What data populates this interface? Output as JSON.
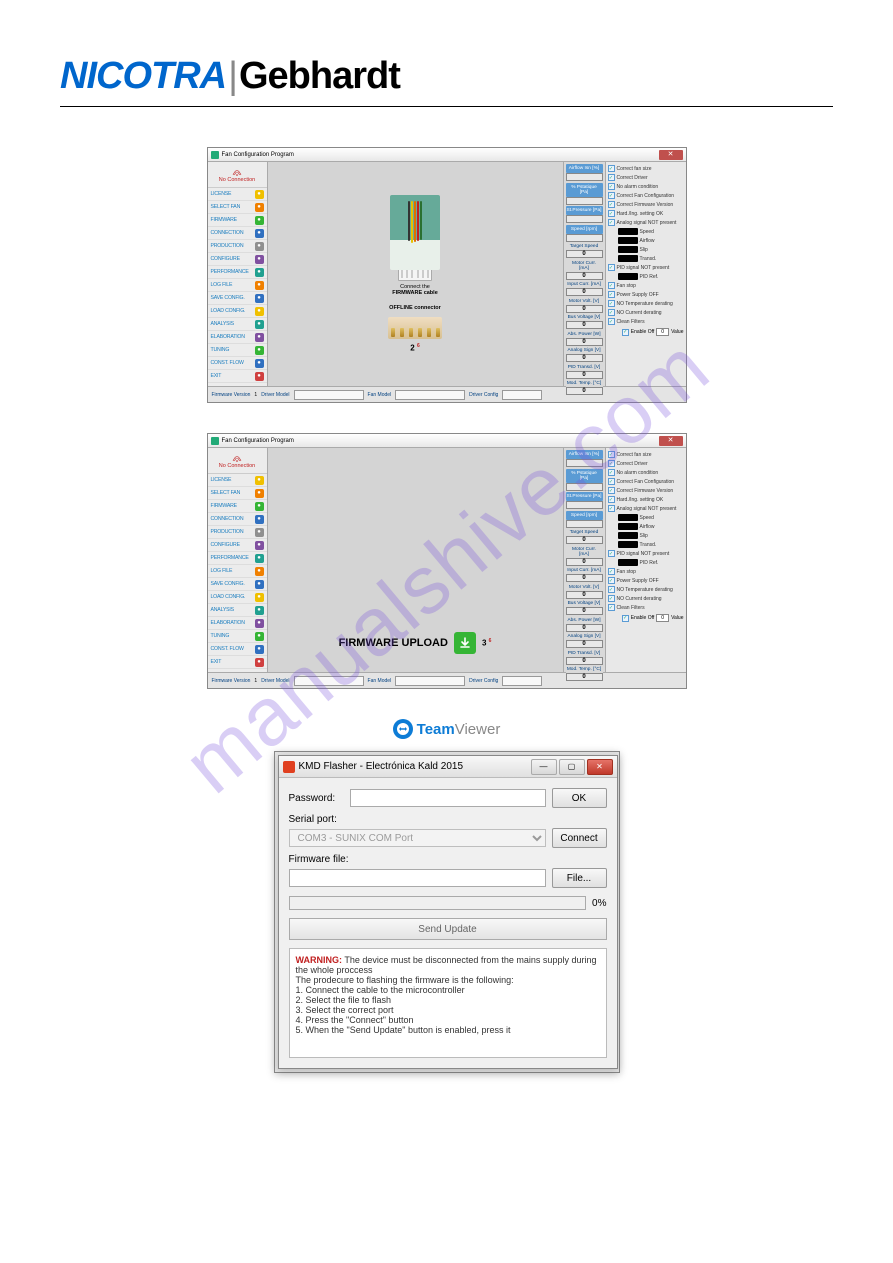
{
  "brand": {
    "left": "NICOTRA",
    "right": "Gebhardt"
  },
  "watermark": "manualshive.com",
  "app": {
    "title": "Fan Configuration Program",
    "no_connection": "No Connection",
    "sidebar": [
      {
        "label": "LICENSE",
        "icn": "icn-yellow"
      },
      {
        "label": "SELECT FAN",
        "icn": "icn-orange"
      },
      {
        "label": "FIRMWARE",
        "icn": "icn-green"
      },
      {
        "label": "CONNECTION",
        "icn": "icn-blue"
      },
      {
        "label": "PRODUCTION",
        "icn": "icn-gray"
      },
      {
        "label": "CONFIGURE",
        "icn": "icn-purple"
      },
      {
        "label": "PERFORMANCE",
        "icn": "icn-teal"
      },
      {
        "label": "LOG FILE",
        "icn": "icn-orange"
      },
      {
        "label": "SAVE CONFIG.",
        "icn": "icn-blue"
      },
      {
        "label": "LOAD CONFIG.",
        "icn": "icn-yellow"
      },
      {
        "label": "ANALYSIS",
        "icn": "icn-teal"
      },
      {
        "label": "ELABORATION",
        "icn": "icn-purple"
      },
      {
        "label": "TUNING",
        "icn": "icn-green"
      },
      {
        "label": "CONST. FLOW",
        "icn": "icn-blue"
      },
      {
        "label": "EXIT",
        "icn": "icn-red"
      }
    ],
    "right_values": [
      {
        "label": "Airflow Isn [%]",
        "btn": true,
        "val": ""
      },
      {
        "label": "% Pstatique [Pa]",
        "btn": true,
        "val": ""
      },
      {
        "label": "St.Pressure [Pa]",
        "btn": true,
        "val": ""
      },
      {
        "label": "Speed [rpm]",
        "btn": true,
        "val": ""
      },
      {
        "label": "Target Speed",
        "val": "0"
      },
      {
        "label": "Motor Curr. [mA]",
        "val": "0"
      },
      {
        "label": "Input Curr. [mA]",
        "val": "0"
      },
      {
        "label": "Motor Volt. [V]",
        "val": "0"
      },
      {
        "label": "Bus Voltage [V]",
        "val": "0"
      },
      {
        "label": "Abs. Power [W]",
        "val": "0"
      },
      {
        "label": "Analog Sign [V]",
        "val": "0"
      },
      {
        "label": "PID Transd. [V]",
        "val": "0"
      },
      {
        "label": "Mod. Temp. [°C]",
        "val": "0"
      }
    ],
    "checks_top": [
      "Correct fan size",
      "Correct Driver",
      "No alarm condition",
      "Correct  Fan Configuration",
      "Correct Firmware Version",
      "Hard./Ing. setting OK",
      "Analog signal NOT present"
    ],
    "indicators": [
      "Speed",
      "Airflow",
      "Slip",
      "Transd."
    ],
    "checks_mid": [
      "PID signal NOT present"
    ],
    "indicators2": [
      "PID Ref."
    ],
    "checks_bot": [
      "Fan stop",
      "Power Supply OFF",
      "NO Temperature derating",
      "NO Current derating",
      "Clean Filters"
    ],
    "enable_off": {
      "label": "Enable Off",
      "val": "0",
      "unit": "Value"
    },
    "footer": {
      "firmware": "Firmware Version",
      "n": "1",
      "driver": "Driver Model",
      "fan": "Fan Model",
      "cfg": "Driver Config"
    },
    "center1": {
      "connect": "Connect the",
      "fw_cable": "FIRMWARE cable",
      "offline": "OFFLINE connector",
      "step": "2",
      "pager": "6"
    },
    "center2": {
      "upload": "FIRMWARE UPLOAD",
      "step": "3",
      "pager": "6"
    }
  },
  "teamviewer": {
    "team": "Team",
    "viewer": "Viewer"
  },
  "kmd": {
    "title": "KMD Flasher - Electrónica Kald 2015",
    "password": "Password:",
    "ok": "OK",
    "serial": "Serial port:",
    "serial_value": "COM3 - SUNIX COM Port",
    "connect": "Connect",
    "fw_file": "Firmware file:",
    "file": "File...",
    "pct": "0%",
    "send": "Send Update",
    "warn_label": "WARNING:",
    "warn_text": " The device must be disconnected from the mains supply during the whole proccess",
    "proc": "The prodecure to flashing the firmware is the following:",
    "s1": "1. Connect the cable to the microcontroller",
    "s2": "2. Select the file to flash",
    "s3": "3. Select the correct port",
    "s4": "4. Press the \"Connect\" button",
    "s5": "5. When the \"Send Update\" button is enabled, press it"
  }
}
